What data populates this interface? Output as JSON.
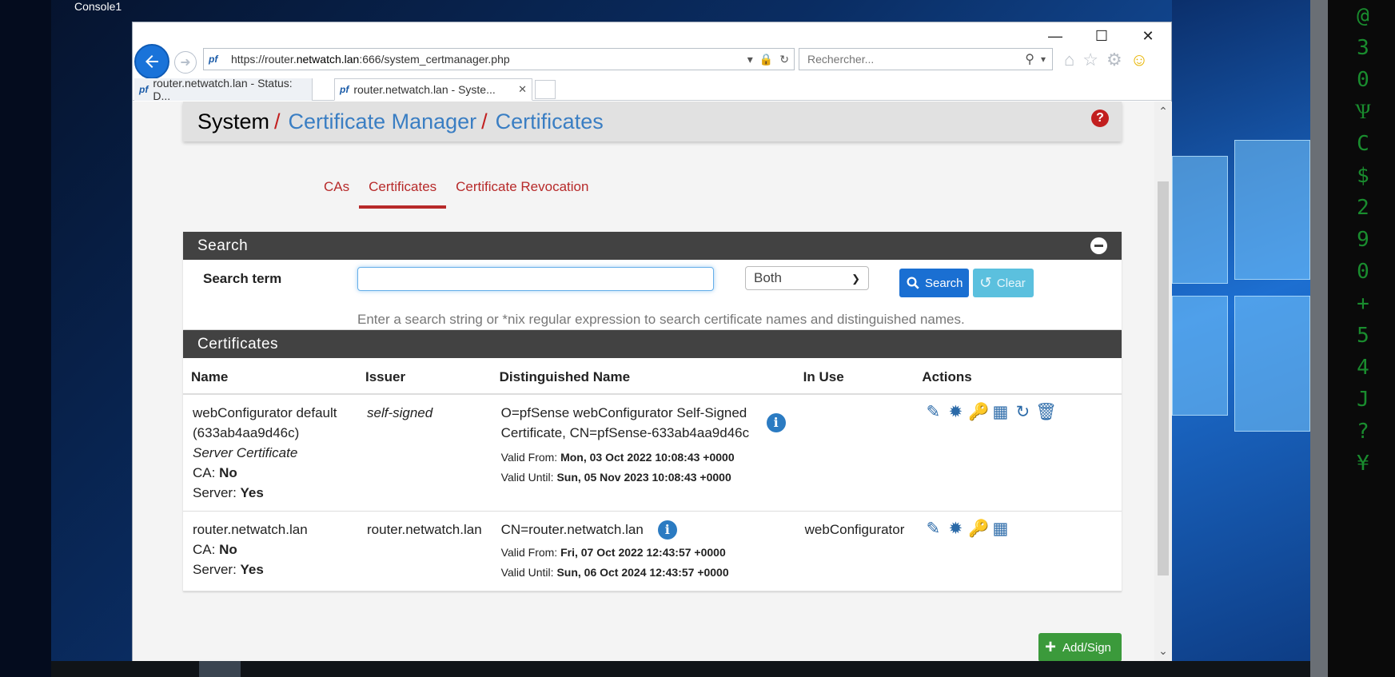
{
  "desktop": {
    "console_label": "Console1",
    "matrix_chars": [
      "@",
      "3",
      "0",
      "Ѱ",
      "C",
      "$",
      "2",
      "9",
      "0",
      "+",
      "5",
      "4",
      "J",
      "?",
      "¥"
    ]
  },
  "browser": {
    "url_prefix": "https://router.",
    "url_host": "netwatch.lan",
    "url_suffix": ":666/system_certmanager.php",
    "search_placeholder": "Rechercher...",
    "tabs": [
      {
        "label": "router.netwatch.lan - Status: D..."
      },
      {
        "label": "router.netwatch.lan - Syste..."
      }
    ]
  },
  "page": {
    "breadcrumb": [
      "System",
      "Certificate Manager",
      "Certificates"
    ],
    "help": "?",
    "nav_tabs": [
      "CAs",
      "Certificates",
      "Certificate Revocation"
    ],
    "search_panel": {
      "title": "Search",
      "label": "Search term",
      "input_value": "",
      "select_value": "Both",
      "search_button": "Search",
      "clear_button": "Clear",
      "help": "Enter a search string or *nix regular expression to search certificate names and distinguished names."
    },
    "certs_panel": {
      "title": "Certificates",
      "columns": [
        "Name",
        "Issuer",
        "Distinguished Name",
        "In Use",
        "Actions"
      ],
      "rows": [
        {
          "name": "webConfigurator default (633ab4aa9d46c)",
          "type": "Server Certificate",
          "ca_label": "CA:",
          "ca_value": "No",
          "server_label": "Server:",
          "server_value": "Yes",
          "issuer": "self-signed",
          "dn": "O=pfSense webConfigurator Self-Signed Certificate, CN=pfSense-633ab4aa9d46c",
          "valid_from_label": "Valid From:",
          "valid_from": "Mon, 03 Oct 2022 10:08:43 +0000",
          "valid_until_label": "Valid Until:",
          "valid_until": "Sun, 05 Nov 2023 10:08:43 +0000",
          "in_use": "",
          "actions": [
            "edit-icon",
            "certificate-icon",
            "key-icon",
            "archive-icon",
            "renew-icon",
            "delete-icon"
          ]
        },
        {
          "name": "router.netwatch.lan",
          "type": "",
          "ca_label": "CA:",
          "ca_value": "No",
          "server_label": "Server:",
          "server_value": "Yes",
          "issuer": "router.netwatch.lan",
          "dn": "CN=router.netwatch.lan",
          "valid_from_label": "Valid From:",
          "valid_from": "Fri, 07 Oct 2022 12:43:57 +0000",
          "valid_until_label": "Valid Until:",
          "valid_until": "Sun, 06 Oct 2024 12:43:57 +0000",
          "in_use": "webConfigurator",
          "actions": [
            "edit-icon",
            "certificate-icon",
            "key-icon",
            "archive-icon"
          ]
        }
      ]
    },
    "add_button": "Add/Sign"
  },
  "colors": {
    "link_blue": "#3a7ec3",
    "tab_red": "#b72a2a",
    "panel_dark": "#424242",
    "search_btn": "#1a6fd2",
    "clear_btn": "#5bc0de",
    "add_btn": "#3b9a3b"
  }
}
